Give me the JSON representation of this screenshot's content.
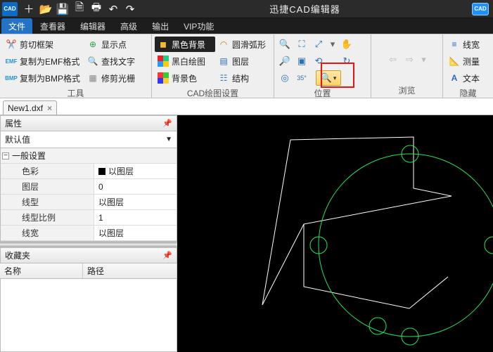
{
  "app": {
    "title": "迅捷CAD编辑器",
    "badge_cad": "CAD",
    "badge_cad2": "CAD"
  },
  "tabs": {
    "file": "文件",
    "viewer": "查看器",
    "editor": "编辑器",
    "advanced": "高级",
    "output": "输出",
    "vip": "VIP功能"
  },
  "ribbon": {
    "groups": {
      "tools": {
        "label": "工具",
        "items": {
          "crop_frame": "剪切框架",
          "copy_emf": "复制为EMF格式",
          "copy_bmp": "复制为BMP格式",
          "show_point": "显示点",
          "find_text": "查找文字",
          "trim_raster": "修剪光栅"
        }
      },
      "draw_settings": {
        "label": "CAD绘图设置",
        "items": {
          "black_bg": "黑色背景",
          "bw": "黑白绘图",
          "bg_color": "背景色",
          "smooth_arc": "圆滑弧形",
          "layers": "图层",
          "structure": "结构"
        }
      },
      "position": {
        "label": "位置"
      },
      "browse": {
        "label": "浏览"
      },
      "hidden": {
        "label": "隐藏",
        "line_width": "线宽",
        "measure": "测量",
        "text": "文本"
      }
    }
  },
  "doc_tab": {
    "name": "New1.dxf"
  },
  "panels": {
    "properties": {
      "title": "属性",
      "default_value": "默认值",
      "group_general": "一般设置",
      "rows": {
        "color": {
          "k": "色彩",
          "v": "以图层"
        },
        "layer": {
          "k": "图层",
          "v": "0"
        },
        "linetype": {
          "k": "线型",
          "v": "以图层"
        },
        "linetype_scale": {
          "k": "线型比例",
          "v": "1"
        },
        "lineweight": {
          "k": "线宽",
          "v": "以图层"
        }
      }
    },
    "favorites": {
      "title": "收藏夹",
      "col_name": "名称",
      "col_path": "路径"
    }
  }
}
